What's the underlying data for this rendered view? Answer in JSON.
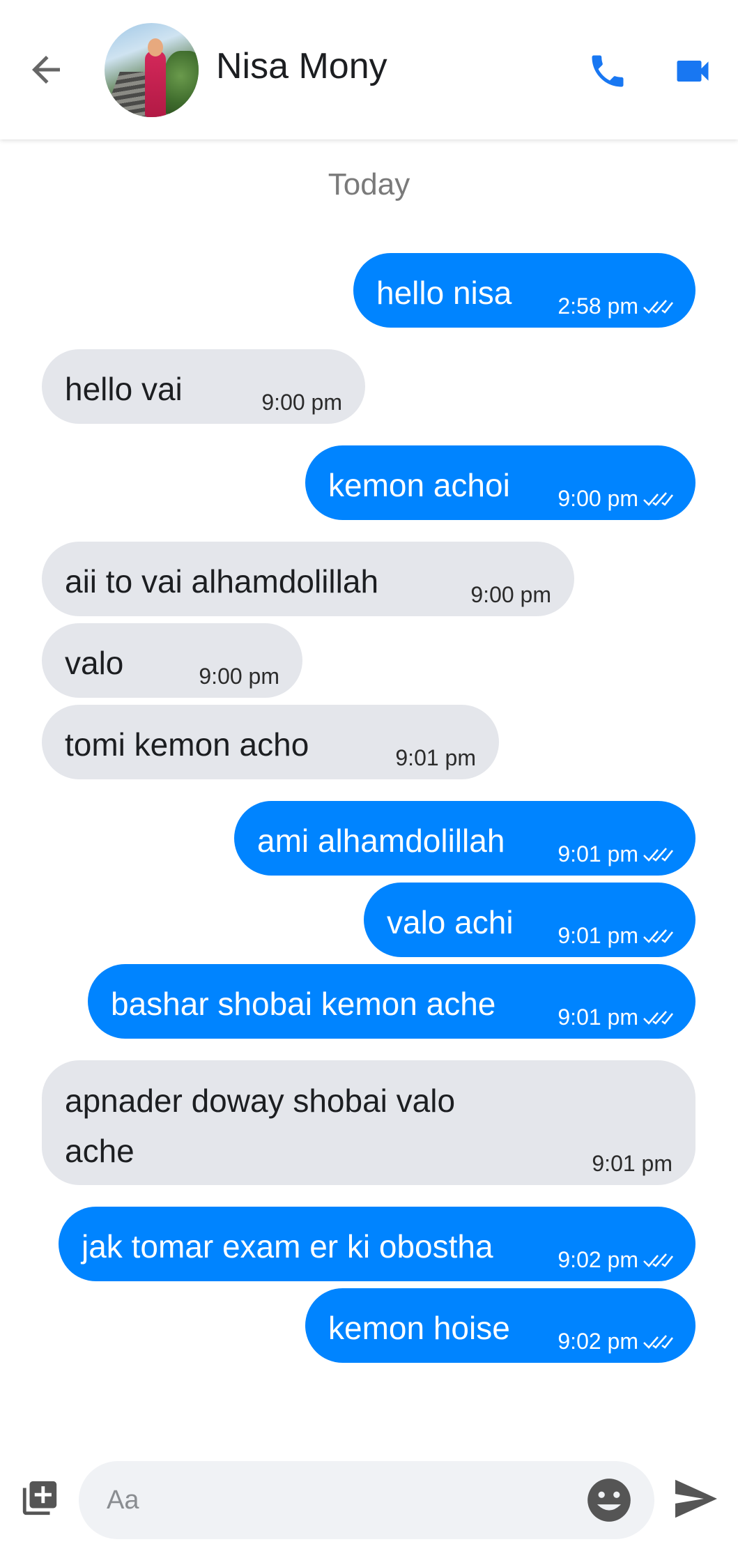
{
  "header": {
    "contact_name": "Nisa Mony",
    "back_icon": "arrow-back-icon",
    "call_icon": "phone-icon",
    "video_icon": "video-camera-icon"
  },
  "date_divider": "Today",
  "messages": [
    {
      "direction": "out",
      "text": "hello nisa",
      "time": "2:58 pm",
      "status": "read"
    },
    {
      "direction": "in",
      "text": "hello vai",
      "time": "9:00 pm"
    },
    {
      "direction": "out",
      "text": "kemon achoi",
      "time": "9:00 pm",
      "status": "read"
    },
    {
      "direction": "in",
      "text": "aii to vai alhamdolillah",
      "time": "9:00 pm"
    },
    {
      "direction": "in",
      "text": "valo",
      "time": "9:00 pm"
    },
    {
      "direction": "in",
      "text": "tomi kemon acho",
      "time": "9:01 pm"
    },
    {
      "direction": "out",
      "text": "ami alhamdolillah",
      "time": "9:01 pm",
      "status": "read"
    },
    {
      "direction": "out",
      "text": "valo achi",
      "time": "9:01 pm",
      "status": "read"
    },
    {
      "direction": "out",
      "text": "bashar shobai kemon ache",
      "time": "9:01 pm",
      "status": "read"
    },
    {
      "direction": "in",
      "text": "apnader doway shobai valo ache",
      "time": "9:01 pm"
    },
    {
      "direction": "out",
      "text": "jak tomar exam er ki obostha",
      "time": "9:02 pm",
      "status": "read"
    },
    {
      "direction": "out",
      "text": "kemon hoise",
      "time": "9:02 pm",
      "status": "read"
    }
  ],
  "composer": {
    "placeholder": "Aa",
    "value": "",
    "add_icon": "add-media-icon",
    "emoji_icon": "emoji-icon",
    "send_icon": "send-icon"
  },
  "colors": {
    "outgoing_bubble": "#0084ff",
    "incoming_bubble": "#e4e6eb",
    "accent": "#1877f2"
  }
}
